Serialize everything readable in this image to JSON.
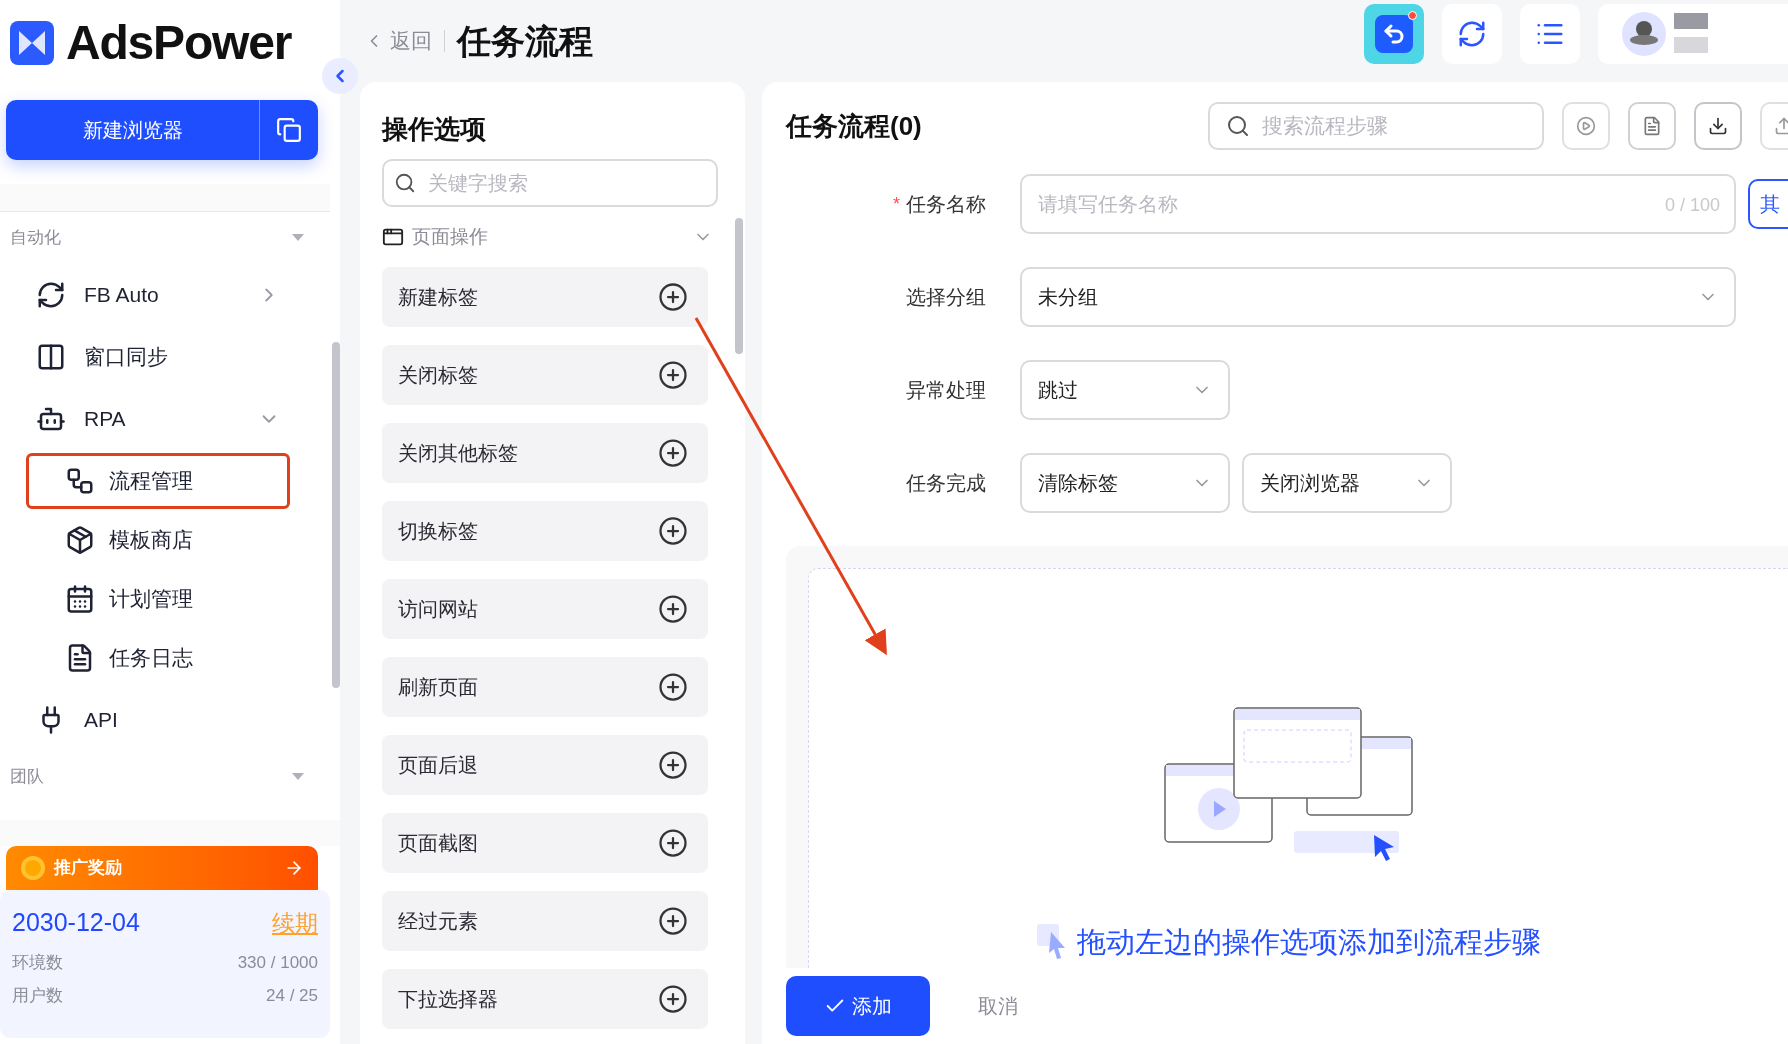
{
  "app": {
    "name": "AdsPower"
  },
  "sidebar": {
    "new_browser_button": "新建浏览器",
    "sections": [
      {
        "title": "自动化",
        "items": [
          {
            "label": "FB Auto",
            "kind": "group",
            "expanded": false
          },
          {
            "label": "窗口同步",
            "kind": "leaf"
          },
          {
            "label": "RPA",
            "kind": "group",
            "expanded": true,
            "children": [
              {
                "label": "流程管理",
                "selected": true
              },
              {
                "label": "模板商店",
                "selected": false
              },
              {
                "label": "计划管理",
                "selected": false
              },
              {
                "label": "任务日志",
                "selected": false
              }
            ]
          },
          {
            "label": "API",
            "kind": "leaf"
          }
        ]
      },
      {
        "title": "团队"
      }
    ],
    "promo": {
      "title": "推广奖励"
    },
    "plan": {
      "expiry": "2030-12-04",
      "renew_link": "续期",
      "stats": [
        {
          "label": "环境数",
          "value": "330 / 1000"
        },
        {
          "label": "用户数",
          "value": "24 / 25"
        }
      ]
    }
  },
  "header": {
    "back": "返回",
    "title": "任务流程",
    "has_notification": true
  },
  "operations": {
    "title": "操作选项",
    "search": {
      "placeholder": "关键字搜索"
    },
    "category": {
      "label": "页面操作",
      "expanded": true
    },
    "items": [
      "新建标签",
      "关闭标签",
      "关闭其他标签",
      "切换标签",
      "访问网站",
      "刷新页面",
      "页面后退",
      "页面截图",
      "经过元素",
      "下拉选择器"
    ]
  },
  "flow": {
    "title": "任务流程(0)",
    "search": {
      "placeholder": "搜索流程步骤"
    },
    "fields": [
      {
        "label": "任务名称",
        "required_mark": "*",
        "kind": "text",
        "placeholder": "请填写任务名称",
        "counter": "0 / 100",
        "side_button": "其"
      },
      {
        "label": "选择分组",
        "kind": "select-wide",
        "values": [
          "未分组"
        ]
      },
      {
        "label": "异常处理",
        "kind": "select",
        "values": [
          "跳过"
        ]
      },
      {
        "label": "任务完成",
        "kind": "select",
        "values": [
          "清除标签",
          "关闭浏览器"
        ]
      }
    ],
    "empty_hint": "拖动左边的操作选项添加到流程步骤",
    "buttons": [
      {
        "label": "添加",
        "kind": "primary"
      },
      {
        "label": "取消",
        "kind": "plain"
      }
    ]
  }
}
